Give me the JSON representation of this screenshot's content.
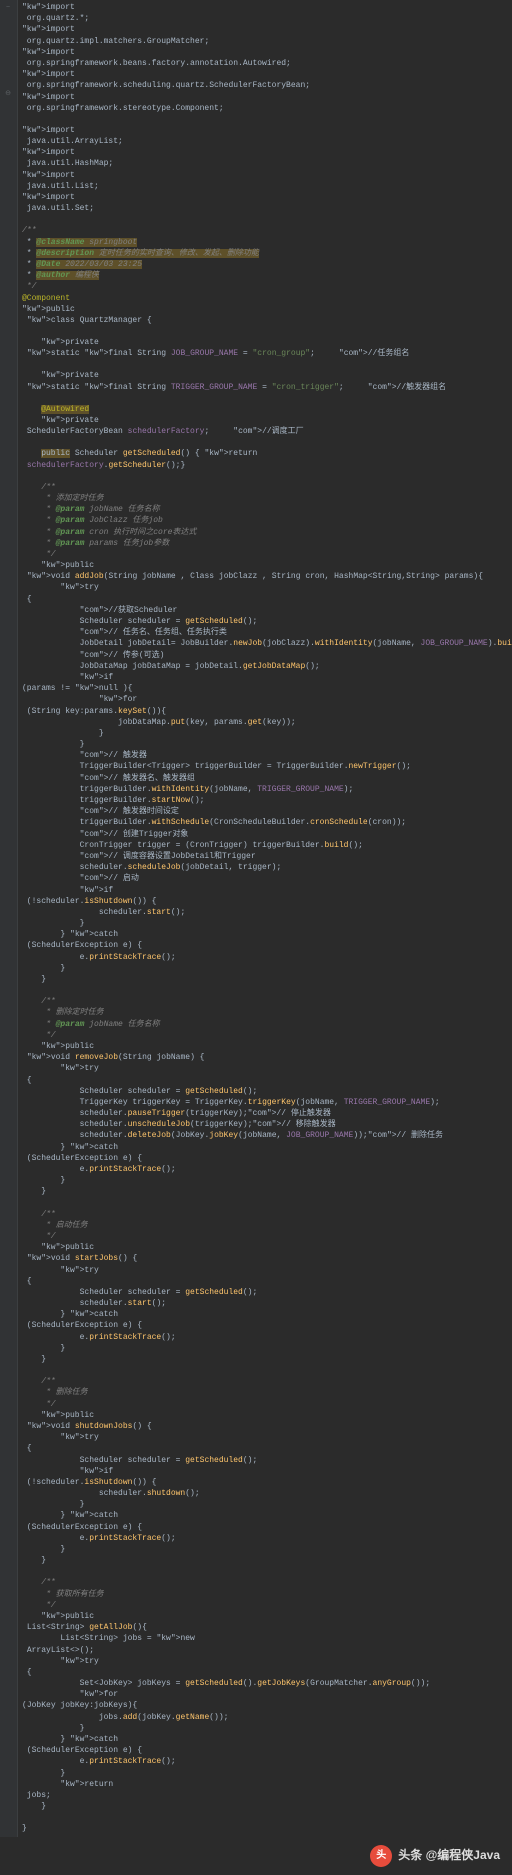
{
  "imports": [
    "import org.quartz.*;",
    "import org.quartz.impl.matchers.GroupMatcher;",
    "import org.springframework.beans.factory.annotation.Autowired;",
    "import org.springframework.scheduling.quartz.SchedulerFactoryBean;",
    "import org.springframework.stereotype.Component;",
    "",
    "import java.util.ArrayList;",
    "import java.util.HashMap;",
    "import java.util.List;",
    "import java.util.Set;"
  ],
  "doc_header": {
    "tags": {
      "className": "@className springboot",
      "description": "@description 定时任务的实时查询、修改、发起、删除功能",
      "date": "@Date 2022/03/03 23:25",
      "author": "@author 编程侠"
    }
  },
  "class_decl": {
    "annotation": "@Component",
    "signature": "public class QuartzManager {"
  },
  "constants": {
    "job_group": "private static final String JOB_GROUP_NAME = \"cron_group\";     //任务组名",
    "trigger_group": "private static final String TRIGGER_GROUP_NAME = \"cron_trigger\";     //触发器组名"
  },
  "autowired": {
    "ann": "@Autowired",
    "field": "private SchedulerFactoryBean schedulerFactory;     //调度工厂"
  },
  "getScheduled": "public Scheduler getScheduled() { return schedulerFactory.getScheduler();}",
  "addJob": {
    "doc": [
      "/**",
      " * 添加定时任务",
      " * @param jobName 任务名称",
      " * @param JobClazz 任务job",
      " * @param cron 执行时间之core表达式",
      " * @param params 任务job参数",
      " */"
    ],
    "sig": "public void addJob(String jobName , Class jobClazz , String cron, HashMap<String,String> params){",
    "body": [
      "    try {",
      "        //获取Scheduler",
      "        Scheduler scheduler = getScheduled();",
      "        // 任务名、任务组、任务执行类",
      "        JobDetail jobDetail= JobBuilder.newJob(jobClazz).withIdentity(jobName, JOB_GROUP_NAME).build();",
      "        // 传参(可选)",
      "        JobDataMap jobDataMap = jobDetail.getJobDataMap();",
      "        if(params != null ){",
      "            for (String key:params.keySet()){",
      "                jobDataMap.put(key, params.get(key));",
      "            }",
      "        }",
      "        // 触发器",
      "        TriggerBuilder<Trigger> triggerBuilder = TriggerBuilder.newTrigger();",
      "        // 触发器名、触发器组",
      "        triggerBuilder.withIdentity(jobName, TRIGGER_GROUP_NAME);",
      "        triggerBuilder.startNow();",
      "        // 触发器时间设定",
      "        triggerBuilder.withSchedule(CronScheduleBuilder.cronSchedule(cron));",
      "        // 创建Trigger对象",
      "        CronTrigger trigger = (CronTrigger) triggerBuilder.build();",
      "        // 调度容器设置JobDetail和Trigger",
      "        scheduler.scheduleJob(jobDetail, trigger);",
      "        // 启动",
      "        if (!scheduler.isShutdown()) {",
      "            scheduler.start();",
      "        }",
      "    } catch (SchedulerException e) {",
      "        e.printStackTrace();",
      "    }",
      "}"
    ]
  },
  "removeJob": {
    "doc": [
      "/**",
      " * 删除定时任务",
      " * @param jobName 任务名称",
      " */"
    ],
    "sig": "public void removeJob(String jobName) {",
    "body": [
      "    try {",
      "        Scheduler scheduler = getScheduled();",
      "        TriggerKey triggerKey = TriggerKey.triggerKey(jobName, TRIGGER_GROUP_NAME);",
      "        scheduler.pauseTrigger(triggerKey);// 停止触发器",
      "        scheduler.unscheduleJob(triggerKey);// 移除触发器",
      "        scheduler.deleteJob(JobKey.jobKey(jobName, JOB_GROUP_NAME));// 删除任务",
      "    } catch (SchedulerException e) {",
      "        e.printStackTrace();",
      "    }",
      "}"
    ]
  },
  "startJobs": {
    "doc": [
      "/**",
      " * 启动任务",
      " */"
    ],
    "sig": "public void startJobs() {",
    "body": [
      "    try {",
      "        Scheduler scheduler = getScheduled();",
      "        scheduler.start();",
      "    } catch (SchedulerException e) {",
      "        e.printStackTrace();",
      "    }",
      "}"
    ]
  },
  "shutdownJobs": {
    "doc": [
      "/**",
      " * 删除任务",
      " */"
    ],
    "sig": "public void shutdownJobs() {",
    "body": [
      "    try {",
      "        Scheduler scheduler = getScheduled();",
      "        if (!scheduler.isShutdown()) {",
      "            scheduler.shutdown();",
      "        }",
      "    } catch (SchedulerException e) {",
      "        e.printStackTrace();",
      "    }",
      "}"
    ]
  },
  "getAllJob": {
    "doc": [
      "/**",
      " * 获取所有任务",
      " */"
    ],
    "sig": "public List<String> getAllJob(){",
    "body": [
      "    List<String> jobs = new ArrayList<>();",
      "    try {",
      "        Set<JobKey> jobKeys = getScheduled().getJobKeys(GroupMatcher.anyGroup());",
      "        for(JobKey jobKey:jobKeys){",
      "            jobs.add(jobKey.getName());",
      "        }",
      "    } catch (SchedulerException e) {",
      "        e.printStackTrace();",
      "    }",
      "    return jobs;",
      "}"
    ]
  },
  "footer": "头条 @编程侠Java"
}
